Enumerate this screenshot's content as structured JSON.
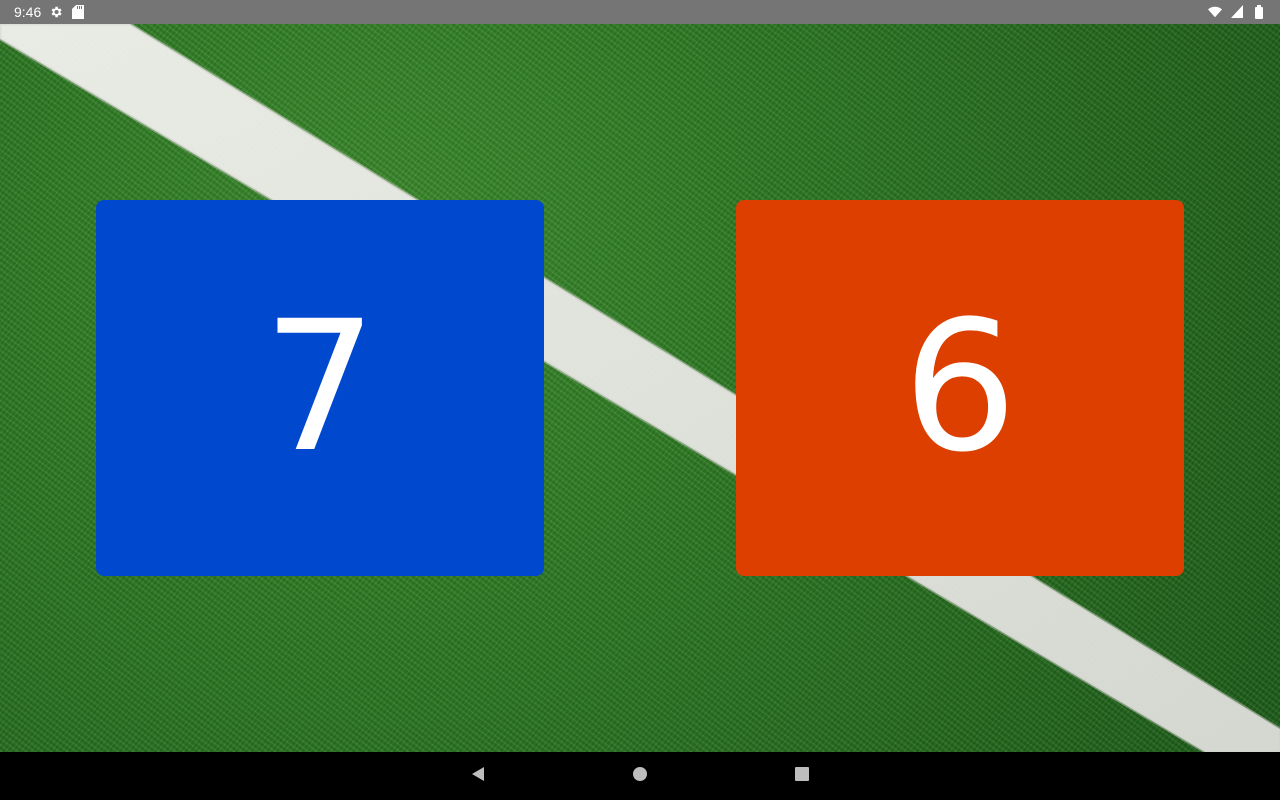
{
  "status_bar": {
    "time": "9:46",
    "icons": [
      "settings-icon",
      "sd-card-icon",
      "wifi-icon",
      "signal-icon",
      "battery-icon"
    ]
  },
  "scoreboard": {
    "left": {
      "score": "7",
      "color": "#0049cf"
    },
    "right": {
      "score": "6",
      "color": "#dd3f00"
    }
  },
  "navigation": {
    "buttons": [
      "back-icon",
      "home-icon",
      "recents-icon"
    ]
  }
}
